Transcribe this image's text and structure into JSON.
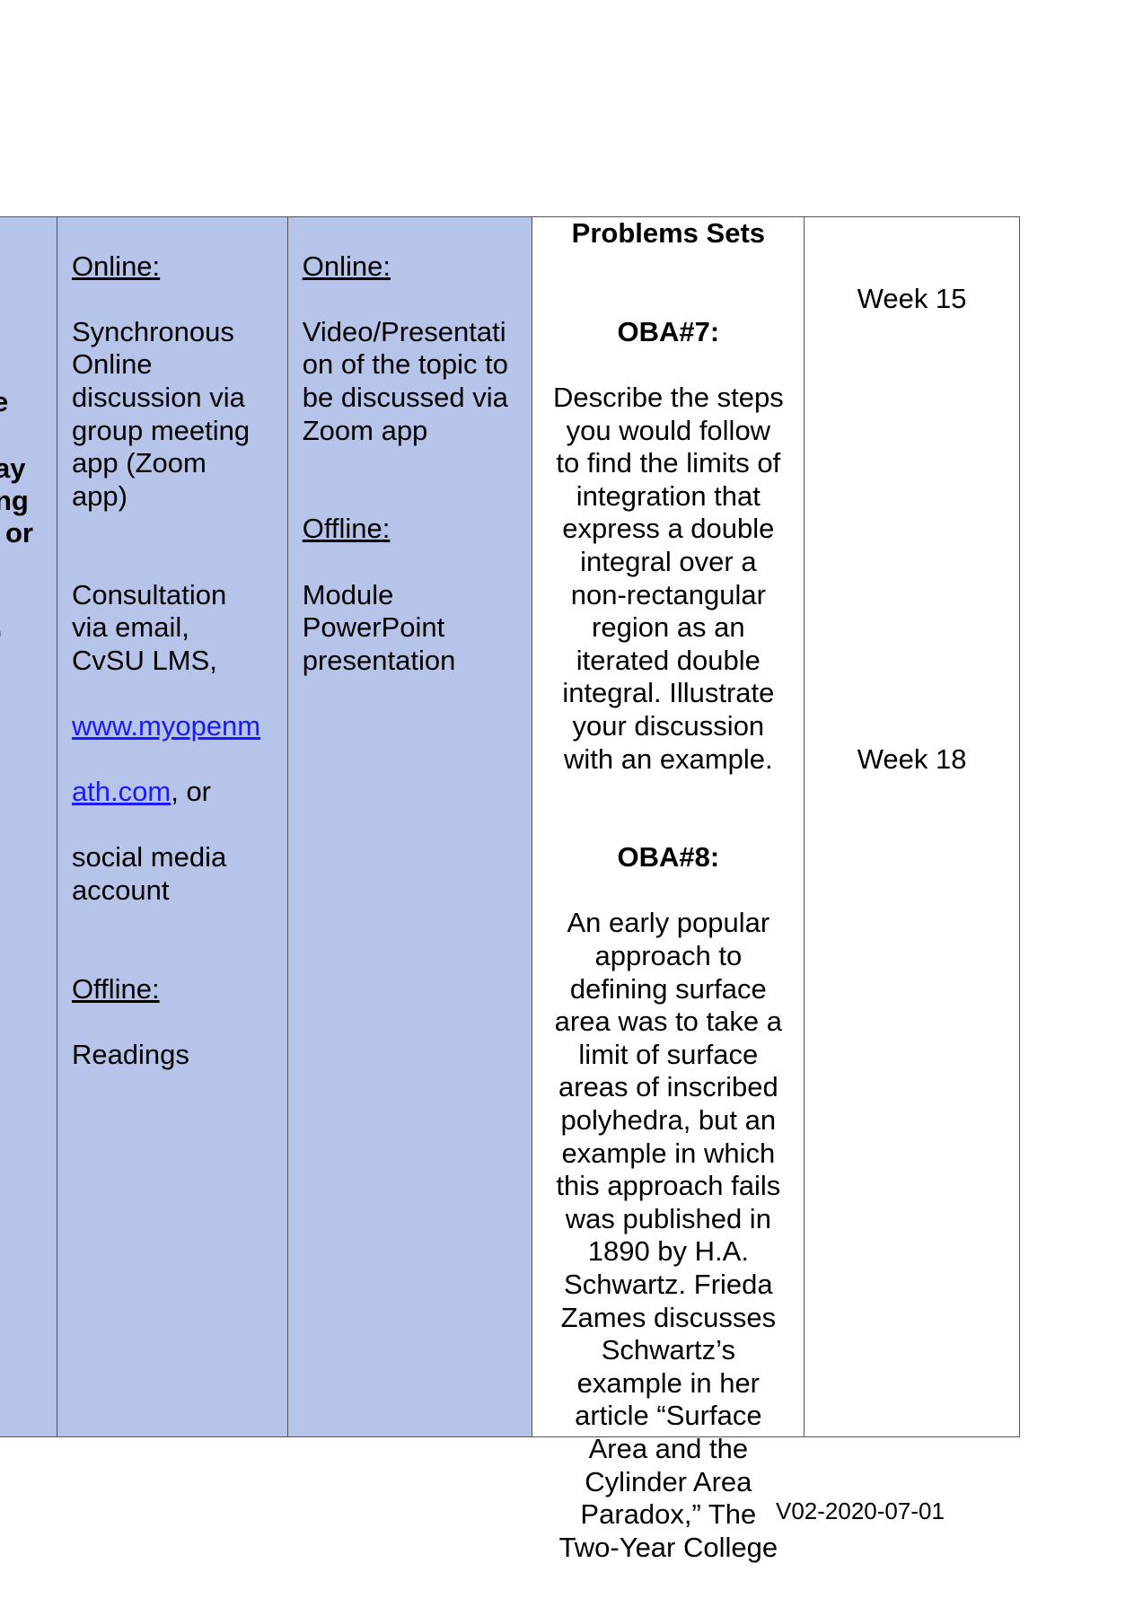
{
  "table": {
    "col0_fragments": [
      "e",
      "ay",
      "ng",
      "or",
      ")"
    ],
    "col1": {
      "online_label": "Online:",
      "online_text": "Synchronous\nOnline\ndiscussion via\ngroup meeting\napp (Zoom\napp)",
      "consult_text": "Consultation\nvia email,\nCvSU LMS,",
      "link_line1": "www.myopenm",
      "link_line2": "ath.com",
      "after_link": ", or",
      "consult_tail": "social media\naccount",
      "offline_label": "Offline:",
      "offline_text": "Readings"
    },
    "col2": {
      "online_label": "Online:",
      "online_text": "Video/Presentati\non of the topic to\nbe discussed via\nZoom app",
      "offline_label": "Offline:",
      "offline_text": "Module\nPowerPoint\npresentation"
    },
    "col3": {
      "header": "Problems Sets",
      "oba7_label": "OBA#7:",
      "oba7_text": "Describe the steps\nyou would follow\nto find the limits of\nintegration that\nexpress a double\nintegral over a\nnon-rectangular\nregion as an\niterated double\nintegral. Illustrate\nyour discussion\nwith an example.",
      "oba8_label": "OBA#8:",
      "oba8_text": "An early popular\napproach to\ndefining surface\narea was to take a\nlimit of surface\nareas of inscribed\npolyhedra, but an\nexample in which\nthis approach fails\nwas published in\n1890 by H.A.\nSchwartz. Frieda\nZames discusses\nSchwartz’s\nexample in her\narticle “Surface\nArea and the\nCylinder Area\nParadox,” The\nTwo-Year College"
    },
    "col4": {
      "week_a": "Week 15",
      "week_b": "Week 18"
    }
  },
  "footer": {
    "version": "V02-2020-07-01"
  },
  "colors": {
    "cell_blue": "#b7c4ea",
    "link": "#1a1aff",
    "border": "#555555"
  }
}
